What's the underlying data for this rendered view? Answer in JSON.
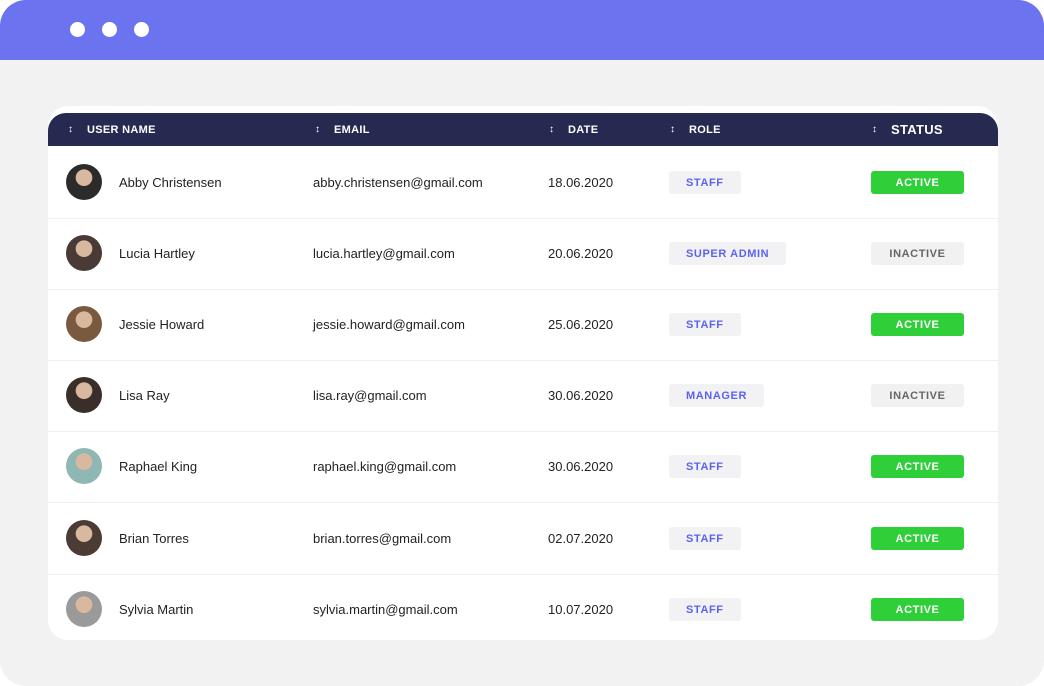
{
  "window": {
    "dots": [
      "window-dot-1",
      "window-dot-2",
      "window-dot-3"
    ]
  },
  "table": {
    "headers": {
      "username": "USER NAME",
      "email": "EMAIL",
      "date": "DATE",
      "role": "ROLE",
      "status": "STATUS"
    },
    "sort_icon": "↕",
    "rows": [
      {
        "name": "Abby Christensen",
        "email": "abby.christensen@gmail.com",
        "date": "18.06.2020",
        "role": "STAFF",
        "status": "ACTIVE",
        "avatar_color": "#2b2b2b"
      },
      {
        "name": "Lucia Hartley",
        "email": "lucia.hartley@gmail.com",
        "date": "20.06.2020",
        "role": "SUPER ADMIN",
        "status": "INACTIVE",
        "avatar_color": "#4a3a36"
      },
      {
        "name": "Jessie Howard",
        "email": "jessie.howard@gmail.com",
        "date": "25.06.2020",
        "role": "STAFF",
        "status": "ACTIVE",
        "avatar_color": "#7a5a3e"
      },
      {
        "name": "Lisa Ray",
        "email": "lisa.ray@gmail.com",
        "date": "30.06.2020",
        "role": "MANAGER",
        "status": "INACTIVE",
        "avatar_color": "#3a2e2a"
      },
      {
        "name": "Raphael King",
        "email": "raphael.king@gmail.com",
        "date": "30.06.2020",
        "role": "STAFF",
        "status": "ACTIVE",
        "avatar_color": "#8fb7b3"
      },
      {
        "name": "Brian Torres",
        "email": "brian.torres@gmail.com",
        "date": "02.07.2020",
        "role": "STAFF",
        "status": "ACTIVE",
        "avatar_color": "#4b3b35"
      },
      {
        "name": "Sylvia Martin",
        "email": "sylvia.martin@gmail.com",
        "date": "10.07.2020",
        "role": "STAFF",
        "status": "ACTIVE",
        "avatar_color": "#9a9a9a"
      }
    ]
  },
  "colors": {
    "titlebar": "#6b73ef",
    "header_bg": "#262a50",
    "active": "#2fcf3a",
    "inactive_bg": "#f1f1f1",
    "role_text": "#5b63ee"
  }
}
